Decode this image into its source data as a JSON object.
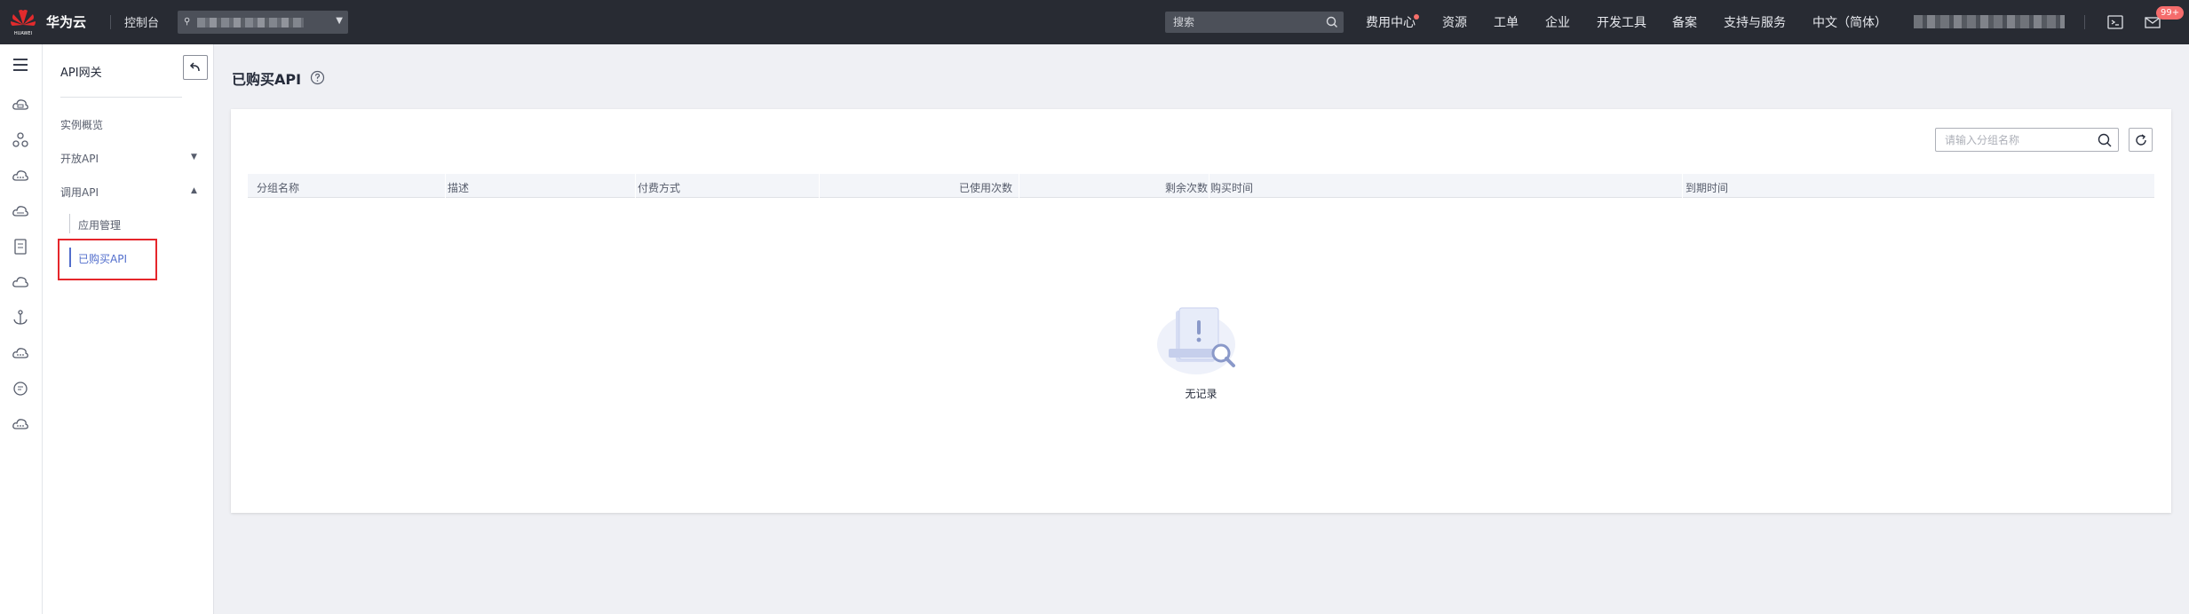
{
  "topbar": {
    "logo_text": "HUAWEI",
    "brand": "华为云",
    "console": "控制台",
    "region_value": "",
    "search_placeholder": "搜索",
    "nav": [
      "费用中心",
      "资源",
      "工单",
      "企业",
      "开发工具",
      "备案",
      "支持与服务",
      "中文（简体）"
    ],
    "message_badge": "99+"
  },
  "rail_icons": [
    "cloud-server-icon",
    "network-icon",
    "database-icon",
    "storage-icon",
    "document-icon",
    "cloud-icon",
    "anchor-icon",
    "cloud-dots-icon",
    "chat-icon",
    "cloud-more-icon"
  ],
  "menu": {
    "title": "API网关",
    "items": [
      {
        "label": "实例概览"
      },
      {
        "label": "开放API",
        "arrow": "▼"
      },
      {
        "label": "调用API",
        "arrow": "▲"
      }
    ],
    "sub_items": [
      {
        "label": "应用管理"
      },
      {
        "label": "已购买API",
        "active": true
      }
    ]
  },
  "main": {
    "title": "已购买API",
    "group_search_placeholder": "请输入分组名称",
    "columns": [
      "分组名称",
      "描述",
      "付费方式",
      "已使用次数",
      "剩余次数",
      "购买时间",
      "到期时间"
    ],
    "rows": [],
    "empty_text": "无记录"
  },
  "colors": {
    "topbar": "#282b33",
    "accent": "#526ecc",
    "highlight": "#e5262b",
    "background": "#eff0f4"
  }
}
